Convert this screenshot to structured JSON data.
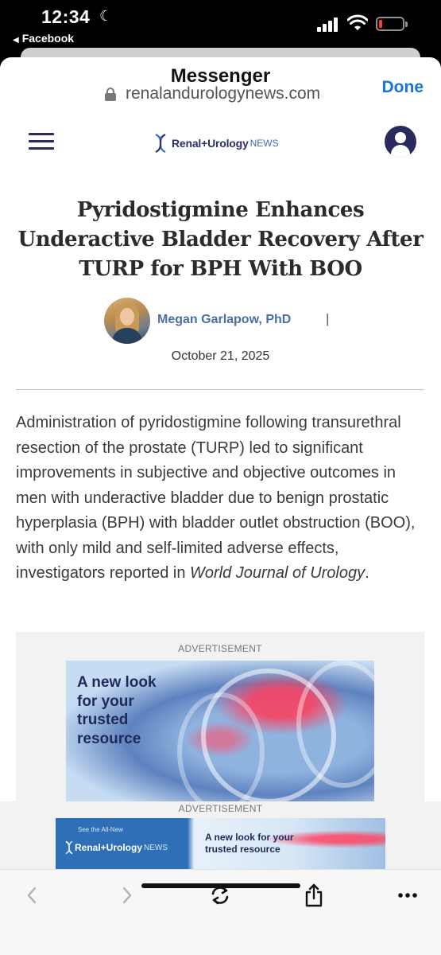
{
  "status_bar": {
    "time": "12:34",
    "back_app": "Facebook"
  },
  "sheet": {
    "title": "Messenger",
    "url": "renalandurologynews.com",
    "done_label": "Done"
  },
  "site": {
    "brand": "Renal+Urology",
    "brand_suffix": "NEWS"
  },
  "article": {
    "headline": "Pyridostigmine Enhances Underactive Bladder Recovery After TURP for BPH With BOO",
    "author": "Megan Garlapow, PhD",
    "author_separator": "|",
    "date": "October 21, 2025",
    "body_lead": "Administration of pyridostigmine following transurethral resection of the prostate (TURP) led to significant improvements in subjective and objective outcomes in men with underactive bladder due to benign prostatic hyperplasia (BPH) with bladder outlet obstruction (BOO), with only mild and self-limited adverse effects, investigators reported in ",
    "body_journal": "World Journal of Urology",
    "body_end": "."
  },
  "ads": {
    "label": "ADVERTISEMENT",
    "inline_tagline": "A new look for your trusted resource",
    "sticky_label": "ADVERTISEMENT",
    "banner_see": "See the All-New",
    "banner_brand": "Renal+Urology",
    "banner_suffix": "NEWS",
    "banner_tagline": "A new look for your trusted resource"
  },
  "colors": {
    "accent": "#1a73d9",
    "brand_navy": "#2a2a5e",
    "author_link": "#4a6fa5"
  },
  "toolbar": {
    "icons": [
      "back-icon",
      "forward-icon",
      "reload-icon",
      "share-icon",
      "more-icon"
    ]
  }
}
